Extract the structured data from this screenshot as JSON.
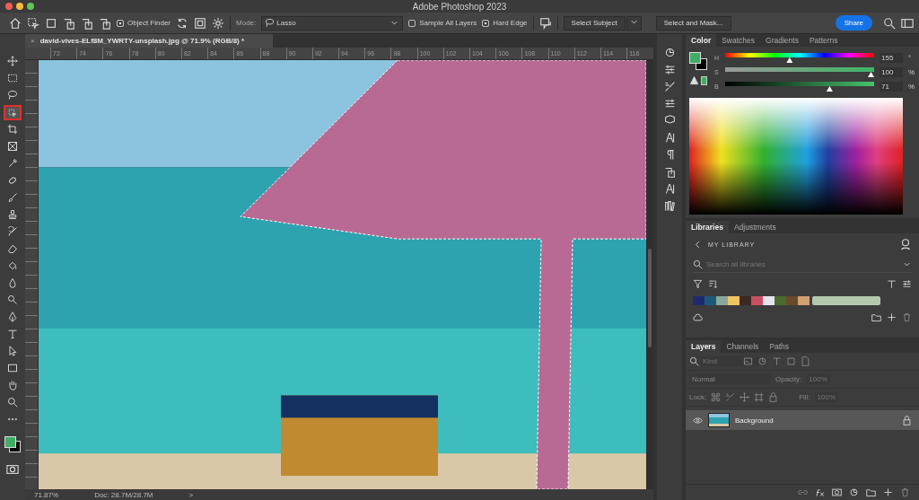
{
  "window": {
    "title": "Adobe Photoshop 2023"
  },
  "options_bar": {
    "object_finder": {
      "label": "Object Finder",
      "checked": true
    },
    "mode_label": "Mode:",
    "mode": "Lasso",
    "sample_all_layers": {
      "label": "Sample All Layers",
      "checked": false
    },
    "hard_edge": {
      "label": "Hard Edge",
      "checked": true
    },
    "select_subject": "Select Subject",
    "select_and_mask": "Select and Mask...",
    "share": "Share"
  },
  "document_tab": {
    "title": "david-vives-ELf8M_YWRTY-unsplash.jpg @ 71.9% (RGB/8) *",
    "close": "×"
  },
  "ruler": [
    "72",
    "74",
    "76",
    "78",
    "80",
    "82",
    "84",
    "86",
    "88",
    "90",
    "92",
    "94",
    "96",
    "98",
    "100",
    "102",
    "104",
    "106",
    "108",
    "110",
    "112",
    "114",
    "116"
  ],
  "tools": [
    {
      "kind": "move",
      "selected": false
    },
    {
      "kind": "marquee",
      "selected": false
    },
    {
      "kind": "lasso",
      "selected": false
    },
    {
      "kind": "object",
      "selected": true
    },
    {
      "kind": "crop",
      "selected": false
    },
    {
      "kind": "frame",
      "selected": false
    },
    {
      "kind": "eyedropper",
      "selected": false
    },
    {
      "kind": "healing",
      "selected": false
    },
    {
      "kind": "brush",
      "selected": false
    },
    {
      "kind": "stamp",
      "selected": false
    },
    {
      "kind": "history",
      "selected": false
    },
    {
      "kind": "eraser",
      "selected": false
    },
    {
      "kind": "bucket",
      "selected": false
    },
    {
      "kind": "blur",
      "selected": false
    },
    {
      "kind": "dodge",
      "selected": false
    },
    {
      "kind": "pen",
      "selected": false
    },
    {
      "kind": "type",
      "selected": false
    },
    {
      "kind": "path",
      "selected": false
    },
    {
      "kind": "rect",
      "selected": false
    },
    {
      "kind": "hand",
      "selected": false
    },
    {
      "kind": "zoom",
      "selected": false
    },
    {
      "kind": "more",
      "selected": false
    }
  ],
  "status_bar": {
    "zoom": "71.87%",
    "doc": "Doc: 28.7M/28.7M",
    "more": ">"
  },
  "color_panel": {
    "tabs": [
      {
        "label": "Color",
        "selected": true
      },
      {
        "label": "Swatches",
        "selected": false
      },
      {
        "label": "Gradients",
        "selected": false
      },
      {
        "label": "Patterns",
        "selected": false
      }
    ],
    "sliders": [
      {
        "kind": "hue",
        "label": "H",
        "level": 0.43,
        "value": "155",
        "unit": "°"
      },
      {
        "kind": "saturation",
        "label": "S",
        "level": 1,
        "value": "100",
        "unit": "%"
      },
      {
        "kind": "brightness",
        "label": "B",
        "level": 0.71,
        "value": "71",
        "unit": "%"
      }
    ]
  },
  "libraries_panel": {
    "tabs": [
      {
        "label": "Libraries",
        "selected": true
      },
      {
        "label": "Adjustments",
        "selected": false
      }
    ],
    "library": "MY LIBRARY",
    "search_placeholder": "Search all libraries",
    "swatches": [
      {
        "color": "#1e2a6e"
      },
      {
        "color": "#1d5a78"
      },
      {
        "color": "#8aa89a"
      },
      {
        "color": "#f0c460"
      },
      {
        "color": "#3c2a22"
      },
      {
        "color": "#c85060"
      },
      {
        "color": "#e4e4ee"
      },
      {
        "color": "#4a6a30"
      },
      {
        "color": "#6a4a2a"
      },
      {
        "color": "#d0a070"
      },
      {
        "color": "#b4c8b0"
      }
    ]
  },
  "layers_panel": {
    "tabs": [
      {
        "label": "Layers",
        "selected": true
      },
      {
        "label": "Channels",
        "selected": false
      },
      {
        "label": "Paths",
        "selected": false
      }
    ],
    "filter_placeholder": "Kind",
    "blend_mode": "Normal",
    "opacity_label": "Opacity:",
    "opacity": "100%",
    "lock_label": "Lock:",
    "fill_label": "Fill:",
    "fill": "100%",
    "layers": [
      {
        "name": "Background",
        "visible": true,
        "locked": true,
        "selected": true
      }
    ]
  }
}
